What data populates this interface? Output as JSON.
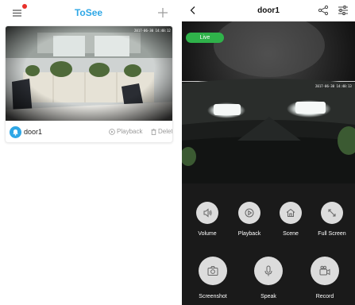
{
  "left": {
    "header": {
      "title": "ToSee",
      "menu_icon": "hamburger-menu-icon",
      "add_icon": "plus-icon",
      "notification_color": "#e8302a",
      "title_color": "#2ea7e6"
    },
    "device_card": {
      "name": "door1",
      "timestamp": "2017-06-30 14:40:12",
      "actions": {
        "playback": "Playback",
        "delete": "Delete"
      }
    }
  },
  "right": {
    "header": {
      "title": "door1",
      "back_icon": "chevron-left-icon",
      "share_icon": "share-icon",
      "settings_icon": "sliders-icon"
    },
    "video": {
      "badge": "Live",
      "badge_color": "#2fb24a",
      "timestamp": "2017-06-30 14:40:13"
    },
    "controls": {
      "row1": [
        {
          "label": "Volume",
          "icon": "speaker-icon"
        },
        {
          "label": "Playback",
          "icon": "play-icon"
        },
        {
          "label": "Scene",
          "icon": "home-icon"
        },
        {
          "label": "Full Screen",
          "icon": "expand-icon"
        }
      ],
      "row2": [
        {
          "label": "Screenshot",
          "icon": "camera-icon"
        },
        {
          "label": "Speak",
          "icon": "microphone-icon"
        },
        {
          "label": "Record",
          "icon": "video-camera-icon"
        }
      ]
    }
  }
}
